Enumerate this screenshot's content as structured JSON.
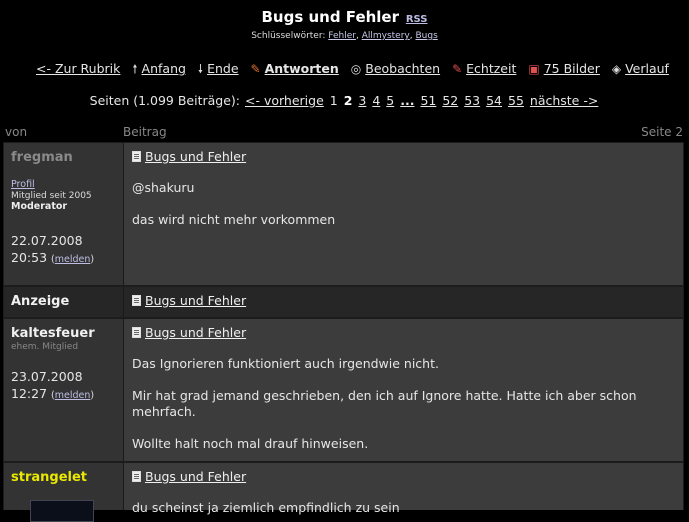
{
  "header": {
    "title": "Bugs und Fehler",
    "rss": "RSS",
    "keywords_label": "Schlüsselwörter:",
    "keywords": [
      "Fehler",
      "Allmystery",
      "Bugs"
    ]
  },
  "nav": {
    "back": "<- Zur Rubrik",
    "start": "Anfang",
    "end": "Ende",
    "reply": "Antworten",
    "watch": "Beobachten",
    "realtime": "Echtzeit",
    "images": "75 Bilder",
    "history": "Verlauf"
  },
  "pager": {
    "prefix": "Seiten (1.099 Beiträge):",
    "prev": "<- vorherige",
    "pages_a": [
      "1"
    ],
    "current": "2",
    "pages_b": [
      "3",
      "4",
      "5"
    ],
    "ellipsis": "...",
    "pages_c": [
      "51",
      "52",
      "53",
      "54",
      "55"
    ],
    "next": "nächste ->"
  },
  "columns": {
    "von": "von",
    "beitrag": "Beitrag",
    "seite": "Seite 2"
  },
  "posts": [
    {
      "user": "fregman",
      "profile": "Profil",
      "since": "Mitglied seit 2005",
      "role": "Moderator",
      "date": "22.07.2008",
      "time": "20:53",
      "report": "melden",
      "subject": "Bugs und Fehler",
      "lines": [
        "@shakuru",
        "das wird nicht mehr vorkommen"
      ]
    },
    {
      "user": "Anzeige",
      "subject": "Bugs und Fehler"
    },
    {
      "user": "kaltesfeuer",
      "status": "ehem. Mitglied",
      "date": "23.07.2008",
      "time": "12:27",
      "report": "melden",
      "subject": "Bugs und Fehler",
      "lines": [
        "Das Ignorieren funktioniert auch irgendwie nicht.",
        "Mir hat grad jemand geschrieben, den ich auf Ignore hatte. Hatte ich aber schon mehrfach.",
        "Wollte halt noch mal drauf hinweisen."
      ]
    },
    {
      "user": "strangelet",
      "subject": "Bugs und Fehler",
      "lines": [
        "du scheinst ja ziemlich empfindlich zu sein"
      ]
    }
  ],
  "colors": {
    "accent_yellow": "#e8e800",
    "link_blue": "#bdbde6"
  }
}
